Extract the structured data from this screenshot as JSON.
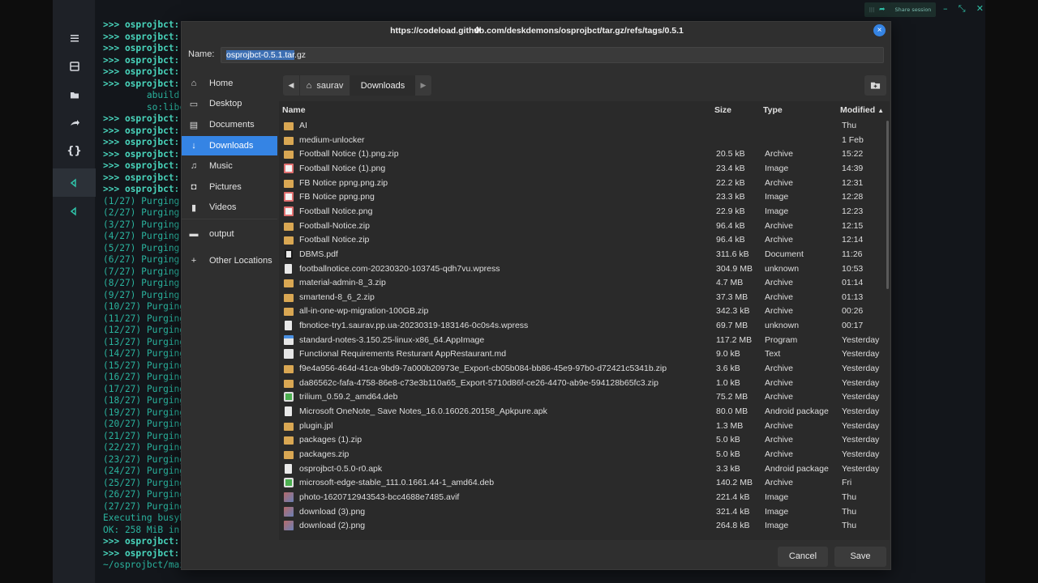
{
  "terminal": {
    "lines": [
      {
        "text": ">>> osprojbct:",
        "kind": "prompt"
      },
      {
        "text": ">>> osprojbct:",
        "kind": "prompt"
      },
      {
        "text": ">>> osprojbct:",
        "kind": "prompt"
      },
      {
        "text": ">>> osprojbct:",
        "kind": "prompt"
      },
      {
        "text": ">>> osprojbct:",
        "kind": "prompt"
      },
      {
        "text": ">>> osprojbct:",
        "kind": "prompt"
      },
      {
        "text": "        abuild",
        "kind": "out"
      },
      {
        "text": "        so:libc",
        "kind": "out"
      },
      {
        "text": ">>> osprojbct:",
        "kind": "prompt"
      },
      {
        "text": ">>> osprojbct:",
        "kind": "prompt"
      },
      {
        "text": ">>> osprojbct:",
        "kind": "prompt"
      },
      {
        "text": ">>> osprojbct:",
        "kind": "prompt"
      },
      {
        "text": ">>> osprojbct:",
        "kind": "prompt"
      },
      {
        "text": ">>> osprojbct:",
        "kind": "prompt"
      },
      {
        "text": ">>> osprojbct:",
        "kind": "prompt"
      },
      {
        "text": "(1/27) Purging",
        "kind": "out"
      },
      {
        "text": "(2/27) Purging",
        "kind": "out"
      },
      {
        "text": "(3/27) Purging",
        "kind": "out"
      },
      {
        "text": "(4/27) Purging",
        "kind": "out"
      },
      {
        "text": "(5/27) Purging",
        "kind": "out"
      },
      {
        "text": "(6/27) Purging",
        "kind": "out"
      },
      {
        "text": "(7/27) Purging",
        "kind": "out"
      },
      {
        "text": "(8/27) Purging",
        "kind": "out"
      },
      {
        "text": "(9/27) Purging",
        "kind": "out"
      },
      {
        "text": "(10/27) Purging",
        "kind": "out"
      },
      {
        "text": "(11/27) Purging",
        "kind": "out"
      },
      {
        "text": "(12/27) Purging",
        "kind": "out"
      },
      {
        "text": "(13/27) Purging",
        "kind": "out"
      },
      {
        "text": "(14/27) Purging",
        "kind": "out"
      },
      {
        "text": "(15/27) Purging",
        "kind": "out"
      },
      {
        "text": "(16/27) Purging",
        "kind": "out"
      },
      {
        "text": "(17/27) Purging",
        "kind": "out"
      },
      {
        "text": "(18/27) Purging",
        "kind": "out"
      },
      {
        "text": "(19/27) Purging",
        "kind": "out"
      },
      {
        "text": "(20/27) Purging",
        "kind": "out"
      },
      {
        "text": "(21/27) Purging",
        "kind": "out"
      },
      {
        "text": "(22/27) Purging",
        "kind": "out"
      },
      {
        "text": "(23/27) Purging",
        "kind": "out"
      },
      {
        "text": "(24/27) Purging",
        "kind": "out"
      },
      {
        "text": "(25/27) Purging",
        "kind": "out"
      },
      {
        "text": "(26/27) Purging",
        "kind": "out"
      },
      {
        "text": "(27/27) Purging",
        "kind": "out"
      },
      {
        "text": "Executing busyb",
        "kind": "out"
      },
      {
        "text": "OK: 258 MiB in",
        "kind": "out"
      },
      {
        "text": ">>> osprojbct:",
        "kind": "prompt"
      },
      {
        "text": ">>> osprojbct:",
        "kind": "prompt"
      },
      {
        "text": "~/osprojbct/main/osprojbct $ []",
        "kind": "out"
      }
    ]
  },
  "share_tray": {
    "label": "Share session"
  },
  "dialog": {
    "title": "https://codeload.github.com/deskdemons/osprojbct/tar.gz/refs/tags/0.5.1",
    "close_icon": "×",
    "name_label": "Name:",
    "name_selected": "osprojbct-0.5.1.tar",
    "name_rest": ".gz",
    "sidebar": [
      {
        "label": "Home",
        "icon": "home-icon",
        "glyph": "⌂",
        "active": false
      },
      {
        "label": "Desktop",
        "icon": "desktop-icon",
        "glyph": "▭",
        "active": false
      },
      {
        "label": "Documents",
        "icon": "documents-icon",
        "glyph": "▤",
        "active": false
      },
      {
        "label": "Downloads",
        "icon": "downloads-icon",
        "glyph": "↓",
        "active": true
      },
      {
        "label": "Music",
        "icon": "music-icon",
        "glyph": "♫",
        "active": false
      },
      {
        "label": "Pictures",
        "icon": "pictures-icon",
        "glyph": "◘",
        "active": false
      },
      {
        "label": "Videos",
        "icon": "videos-icon",
        "glyph": "▮",
        "active": false
      },
      {
        "label": "output",
        "icon": "drive-icon",
        "glyph": "▬",
        "active": false
      },
      {
        "label": "Other Locations",
        "icon": "plus-icon",
        "glyph": "+",
        "active": false
      }
    ],
    "path": {
      "home": "saurav",
      "current": "Downloads"
    },
    "columns": {
      "name": "Name",
      "size": "Size",
      "type": "Type",
      "modified": "Modified"
    },
    "files": [
      {
        "name": "AI",
        "size": "",
        "type": "",
        "modified": "Thu",
        "icon": "folder"
      },
      {
        "name": "medium-unlocker",
        "size": "",
        "type": "",
        "modified": "1 Feb",
        "icon": "folder"
      },
      {
        "name": "Football Notice (1).png.zip",
        "size": "20.5 kB",
        "type": "Archive",
        "modified": "15:22",
        "icon": "folder"
      },
      {
        "name": "Football Notice (1).png",
        "size": "23.4 kB",
        "type": "Image",
        "modified": "14:39",
        "icon": "img-red"
      },
      {
        "name": "FB Notice ppng.png.zip",
        "size": "22.2 kB",
        "type": "Archive",
        "modified": "12:31",
        "icon": "folder"
      },
      {
        "name": "FB Notice ppng.png",
        "size": "23.3 kB",
        "type": "Image",
        "modified": "12:28",
        "icon": "img-red"
      },
      {
        "name": "Football Notice.png",
        "size": "22.9 kB",
        "type": "Image",
        "modified": "12:23",
        "icon": "img-red"
      },
      {
        "name": "Football-Notice.zip",
        "size": "96.4 kB",
        "type": "Archive",
        "modified": "12:15",
        "icon": "folder"
      },
      {
        "name": "Football Notice.zip",
        "size": "96.4 kB",
        "type": "Archive",
        "modified": "12:14",
        "icon": "folder"
      },
      {
        "name": "DBMS.pdf",
        "size": "311.6 kB",
        "type": "Document",
        "modified": "11:26",
        "icon": "pdf"
      },
      {
        "name": "footballnotice.com-20230320-103745-qdh7vu.wpress",
        "size": "304.9 MB",
        "type": "unknown",
        "modified": "10:53",
        "icon": "doc"
      },
      {
        "name": "material-admin-8_3.zip",
        "size": "4.7 MB",
        "type": "Archive",
        "modified": "01:14",
        "icon": "folder"
      },
      {
        "name": "smartend-8_6_2.zip",
        "size": "37.3 MB",
        "type": "Archive",
        "modified": "01:13",
        "icon": "folder"
      },
      {
        "name": "all-in-one-wp-migration-100GB.zip",
        "size": "342.3 kB",
        "type": "Archive",
        "modified": "00:26",
        "icon": "folder"
      },
      {
        "name": "fbnotice-try1.saurav.pp.ua-20230319-183146-0c0s4s.wpress",
        "size": "69.7 MB",
        "type": "unknown",
        "modified": "00:17",
        "icon": "doc"
      },
      {
        "name": "standard-notes-3.150.25-linux-x86_64.AppImage",
        "size": "117.2 MB",
        "type": "Program",
        "modified": "Yesterday",
        "icon": "app"
      },
      {
        "name": "Functional Requirements Resturant AppRestaurant.md",
        "size": "9.0 kB",
        "type": "Text",
        "modified": "Yesterday",
        "icon": "md"
      },
      {
        "name": "f9e4a956-464d-41ca-9bd9-7a000b20973e_Export-cb05b084-bb86-45e9-97b0-d72421c5341b.zip",
        "size": "3.6 kB",
        "type": "Archive",
        "modified": "Yesterday",
        "icon": "folder"
      },
      {
        "name": "da86562c-fafa-4758-86e8-c73e3b110a65_Export-5710d86f-ce26-4470-ab9e-594128b65fc3.zip",
        "size": "1.0 kB",
        "type": "Archive",
        "modified": "Yesterday",
        "icon": "folder"
      },
      {
        "name": "trilium_0.59.2_amd64.deb",
        "size": "75.2 MB",
        "type": "Archive",
        "modified": "Yesterday",
        "icon": "deb"
      },
      {
        "name": "Microsoft OneNote_ Save Notes_16.0.16026.20158_Apkpure.apk",
        "size": "80.0 MB",
        "type": "Android package",
        "modified": "Yesterday",
        "icon": "doc"
      },
      {
        "name": "plugin.jpl",
        "size": "1.3 MB",
        "type": "Archive",
        "modified": "Yesterday",
        "icon": "folder"
      },
      {
        "name": "packages (1).zip",
        "size": "5.0 kB",
        "type": "Archive",
        "modified": "Yesterday",
        "icon": "folder"
      },
      {
        "name": "packages.zip",
        "size": "5.0 kB",
        "type": "Archive",
        "modified": "Yesterday",
        "icon": "folder"
      },
      {
        "name": "osprojbct-0.5.0-r0.apk",
        "size": "3.3 kB",
        "type": "Android package",
        "modified": "Yesterday",
        "icon": "doc"
      },
      {
        "name": "microsoft-edge-stable_111.0.1661.44-1_amd64.deb",
        "size": "140.2 MB",
        "type": "Archive",
        "modified": "Fri",
        "icon": "deb"
      },
      {
        "name": "photo-1620712943543-bcc4688e7485.avif",
        "size": "221.4 kB",
        "type": "Image",
        "modified": "Thu",
        "icon": "img-pic"
      },
      {
        "name": "download (3).png",
        "size": "321.4 kB",
        "type": "Image",
        "modified": "Thu",
        "icon": "img-pic"
      },
      {
        "name": "download (2).png",
        "size": "264.8 kB",
        "type": "Image",
        "modified": "Thu",
        "icon": "img-pic"
      }
    ],
    "cancel_label": "Cancel",
    "save_label": "Save"
  }
}
